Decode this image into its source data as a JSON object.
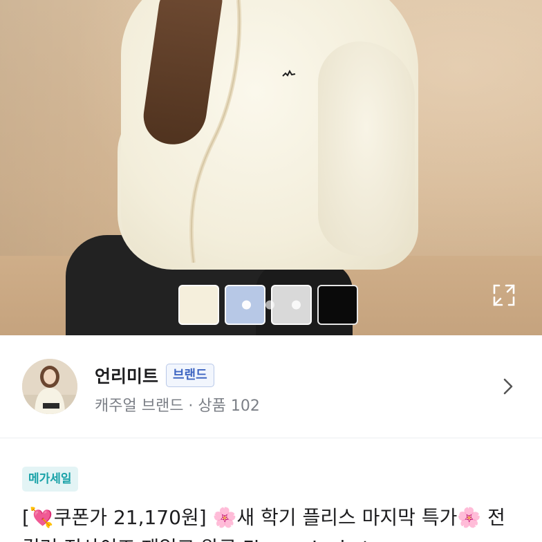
{
  "hero": {
    "image": "product-photo-fleece-jacket",
    "swatches": [
      {
        "name": "ivory",
        "color": "#f5efdc",
        "selected": false
      },
      {
        "name": "sky-blue",
        "color": "#b7c8e6",
        "selected": true
      },
      {
        "name": "light-gray",
        "color": "#d9d9d9",
        "selected": false
      },
      {
        "name": "black",
        "color": "#0a0a0a",
        "selected": false
      }
    ],
    "page_dots": 3,
    "active_dot": 0,
    "expand_icon": "expand-icon"
  },
  "shop": {
    "name": "언리미트",
    "badge": "브랜드",
    "subtitle": "캐주얼 브랜드 · 상품 102",
    "chevron_icon": "chevron-right-icon"
  },
  "product": {
    "sale_tag": "메가세일",
    "title_line1": "[💘쿠폰가 21,170원] 🌸새 학기 플리스 마지막 특가🌸 전",
    "title_line2": "컬러 전사이즈 재입고 완료 Fleece Jacket"
  }
}
